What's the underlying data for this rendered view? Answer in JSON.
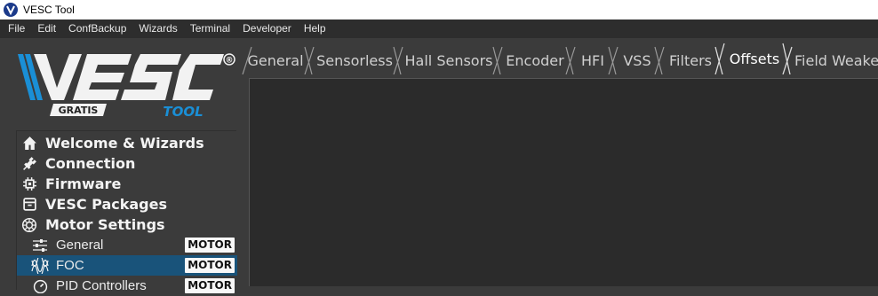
{
  "window": {
    "title": "VESC Tool"
  },
  "menubar": {
    "items": [
      "File",
      "Edit",
      "ConfBackup",
      "Wizards",
      "Terminal",
      "Developer",
      "Help"
    ]
  },
  "logo": {
    "wordmark": "VESC",
    "left_tag": "GRATIS",
    "right_tag": "TOOL",
    "registered": "®",
    "accent_color": "#1a8fd6"
  },
  "sidebar": {
    "items": [
      {
        "label": "Welcome & Wizards",
        "icon": "home-icon"
      },
      {
        "label": "Connection",
        "icon": "plug-icon"
      },
      {
        "label": "Firmware",
        "icon": "chip-icon"
      },
      {
        "label": "VESC Packages",
        "icon": "package-icon"
      },
      {
        "label": "Motor Settings",
        "icon": "motor-icon"
      },
      {
        "label": "General",
        "icon": "sliders-icon",
        "badge": "MOTOR"
      },
      {
        "label": "FOC",
        "icon": "foc-waveform-icon",
        "badge": "MOTOR",
        "selected": true
      },
      {
        "label": "PID Controllers",
        "icon": "gauge-icon",
        "badge": "MOTOR"
      }
    ]
  },
  "tabs": {
    "items": [
      "General",
      "Sensorless",
      "Hall Sensors",
      "Encoder",
      "HFI",
      "VSS",
      "Filters",
      "Offsets",
      "Field Weaker"
    ],
    "active": "Offsets"
  },
  "colors": {
    "background": "#3b3b3b",
    "menubar": "#2d2d2d",
    "panel": "#2b2b2b",
    "selection": "#19537a"
  }
}
